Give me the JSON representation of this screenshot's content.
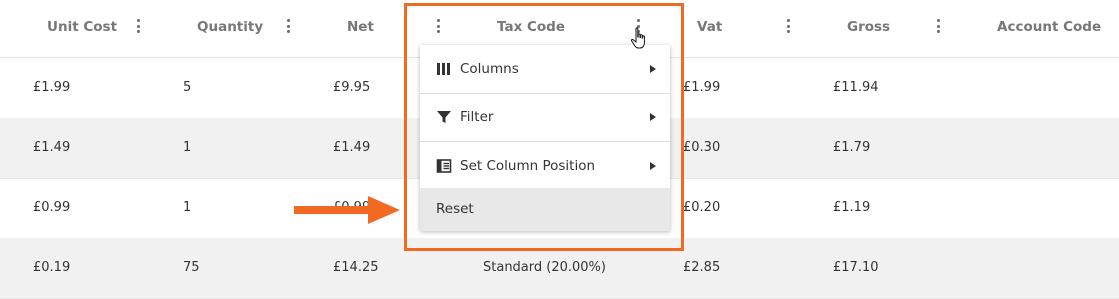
{
  "columns": {
    "unit_cost": "Unit Cost",
    "quantity": "Quantity",
    "net": "Net",
    "tax_code": "Tax Code",
    "vat": "Vat",
    "gross": "Gross",
    "account_code": "Account Code"
  },
  "rows": [
    {
      "unit_cost": "£1.99",
      "quantity": "5",
      "net": "£9.95",
      "tax_code": "",
      "vat": "£1.99",
      "gross": "£11.94"
    },
    {
      "unit_cost": "£1.49",
      "quantity": "1",
      "net": "£1.49",
      "tax_code": "",
      "vat": "£0.30",
      "gross": "£1.79"
    },
    {
      "unit_cost": "£0.99",
      "quantity": "1",
      "net": "£0.99",
      "tax_code": "",
      "vat": "£0.20",
      "gross": "£1.19"
    },
    {
      "unit_cost": "£0.19",
      "quantity": "75",
      "net": "£14.25",
      "tax_code": "Standard (20.00%)",
      "vat": "£2.85",
      "gross": "£17.10"
    }
  ],
  "menu": {
    "columns_label": "Columns",
    "filter_label": "Filter",
    "set_column_position_label": "Set Column Position",
    "reset_label": "Reset"
  },
  "colors": {
    "annotation": "#f26a21",
    "row_stripe": "#f1f1f1",
    "menu_hover": "#e8e8e8"
  }
}
